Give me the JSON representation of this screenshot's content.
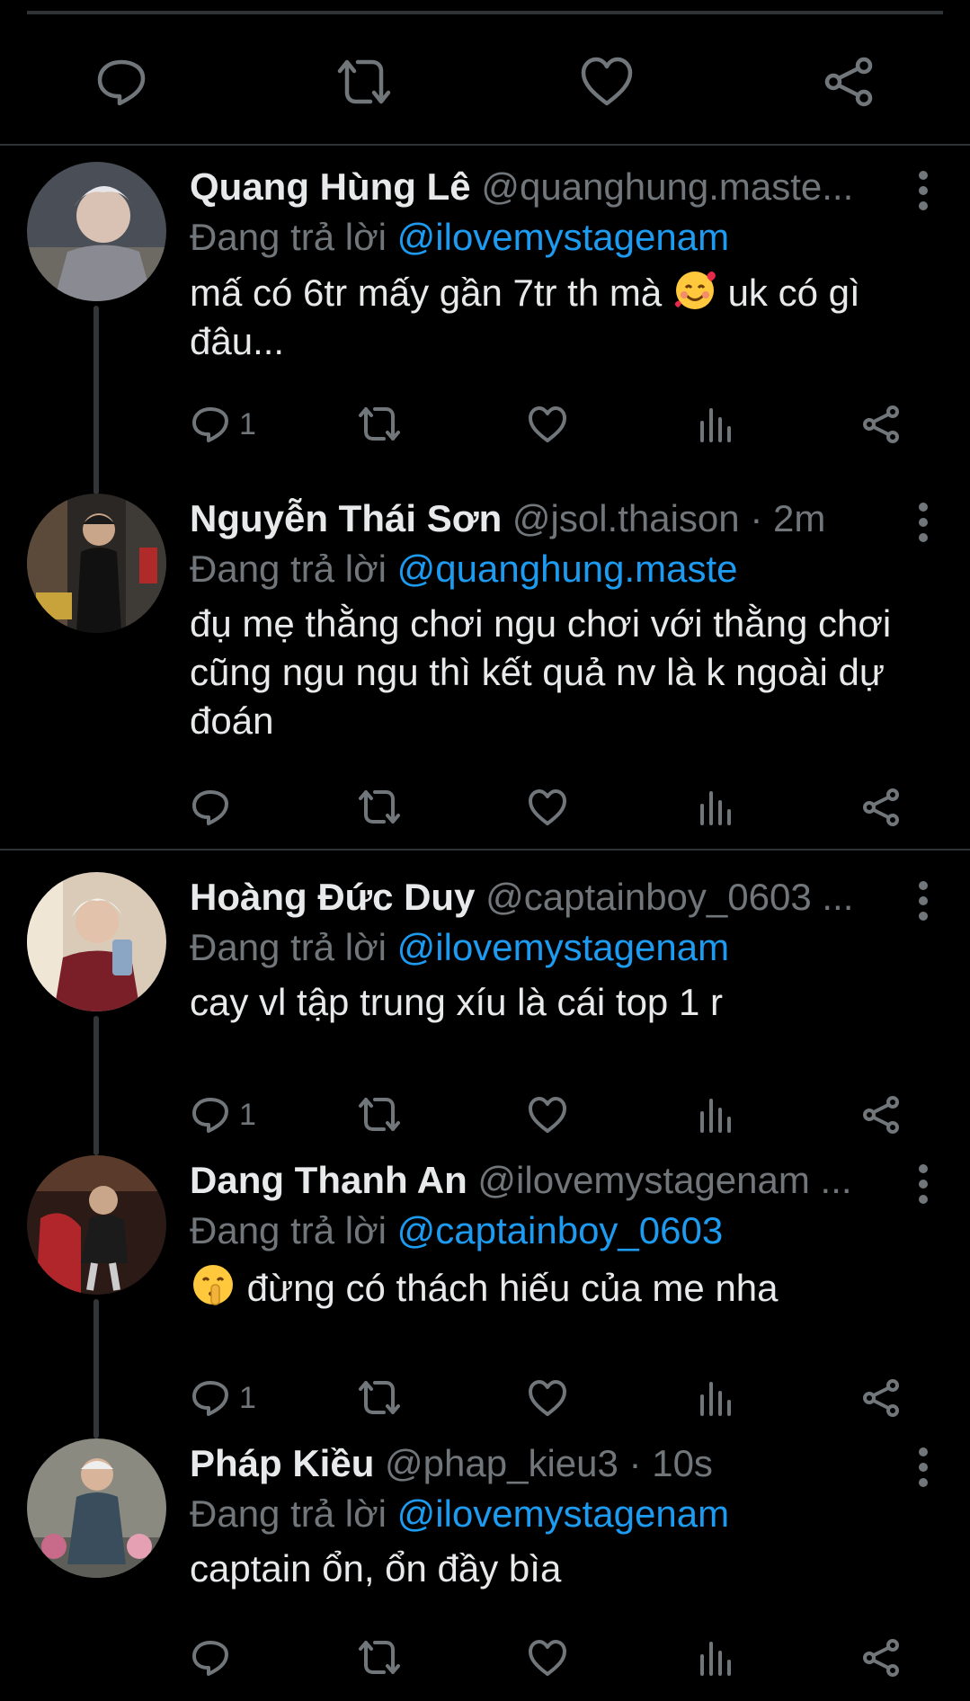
{
  "colors": {
    "background": "#000000",
    "text": "#e7e9ea",
    "muted": "#71767b",
    "accent": "#1d9bf0",
    "divider": "#2f3336"
  },
  "top_actions": [
    "reply-icon",
    "retweet-icon",
    "like-icon",
    "share-icon"
  ],
  "tweets": [
    {
      "name": "Quang Hùng Lê",
      "handle": "@quanghung.maste...",
      "reply_prefix": "Đang trả lời",
      "mention": "@ilovemystagenam",
      "text_before": "mấ có 6tr mấy gần 7tr th mà",
      "emoji": "smiling-face-with-hearts",
      "text_after": "uk có gì đâu...",
      "reply_count": "1"
    },
    {
      "name": "Nguyễn Thái Sơn",
      "handle": "@jsol.thaison · 2m",
      "reply_prefix": "Đang trả lời",
      "mention": "@quanghung.maste",
      "text_before": "",
      "emoji": "",
      "text_after": "đụ mẹ thằng chơi ngu chơi với thằng chơi cũng ngu ngu thì kết quả nv là k ngoài dự đoán",
      "reply_count": ""
    },
    {
      "name": "Hoàng Đức Duy",
      "handle": "@captainboy_0603 ...",
      "reply_prefix": "Đang trả lời",
      "mention": "@ilovemystagenam",
      "text_before": "",
      "emoji": "",
      "text_after": "cay vl tập trung xíu là cái top 1 r",
      "reply_count": "1"
    },
    {
      "name": "Dang Thanh An",
      "handle": "@ilovemystagenam ...",
      "reply_prefix": "Đang trả lời",
      "mention": "@captainboy_0603",
      "text_before": "",
      "emoji": "shushing-face",
      "text_after": "đừng có thách hiếu của me nha",
      "reply_count": "1"
    },
    {
      "name": "Pháp Kiều",
      "handle": "@phap_kieu3 · 10s",
      "reply_prefix": "Đang trả lời",
      "mention": "@ilovemystagenam",
      "text_before": "",
      "emoji": "",
      "text_after": "captain ổn, ổn đầy bìa",
      "reply_count": ""
    }
  ]
}
